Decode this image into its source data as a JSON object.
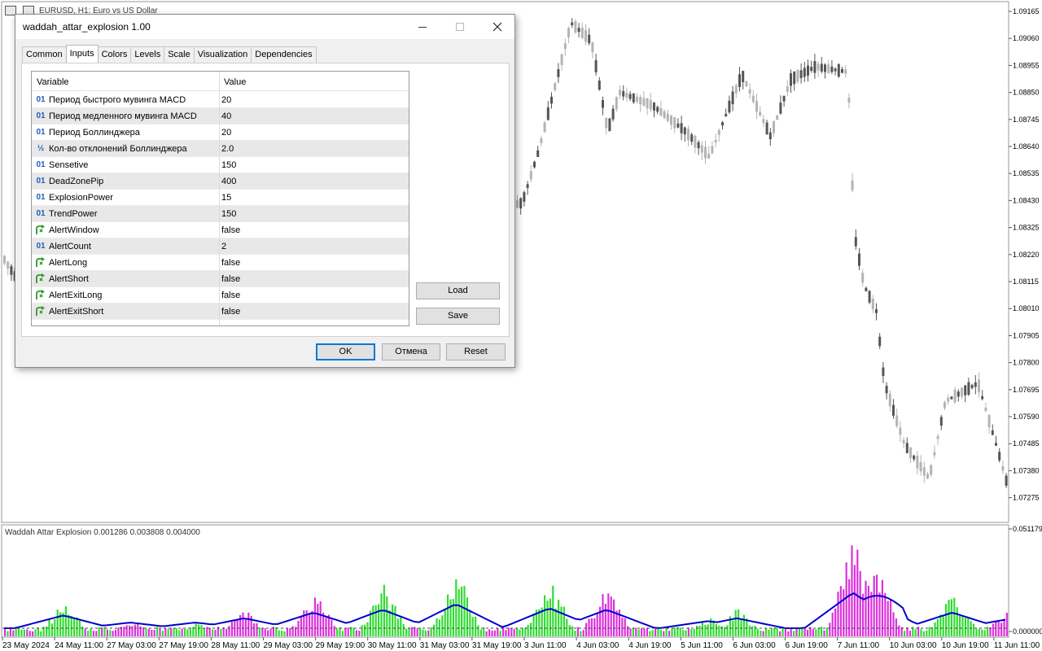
{
  "chart": {
    "title": "EURUSD, H1:  Euro vs US Dollar",
    "price_axis": [
      "1.09165",
      "1.09060",
      "1.08955",
      "1.08850",
      "1.08745",
      "1.08640",
      "1.08535",
      "1.08430",
      "1.08325",
      "1.08220",
      "1.08115",
      "1.08010",
      "1.07905",
      "1.07800",
      "1.07695",
      "1.07590",
      "1.07485",
      "1.07380",
      "1.07275"
    ],
    "time_axis": [
      "23 May 2024",
      "24 May 11:00",
      "27 May 03:00",
      "27 May 19:00",
      "28 May 11:00",
      "29 May 03:00",
      "29 May 19:00",
      "30 May 11:00",
      "31 May 03:00",
      "31 May 19:00",
      "3 Jun 11:00",
      "4 Jun 03:00",
      "4 Jun 19:00",
      "5 Jun 11:00",
      "6 Jun 03:00",
      "6 Jun 19:00",
      "7 Jun 11:00",
      "10 Jun 03:00",
      "10 Jun 19:00",
      "11 Jun 11:00"
    ],
    "indicator_title": "Waddah Attar Explosion 0.001286 0.003808 0.004000",
    "indicator_axis": [
      "0.051179",
      "0.000000"
    ],
    "colors": {
      "up": "#32dc32",
      "down": "#dc32dc",
      "explosion_line": "#0000cc",
      "candle_bull": "#b4b4b4",
      "candle_bear": "#555555"
    }
  },
  "dialog": {
    "title": "waddah_attar_explosion 1.00",
    "tabs": [
      {
        "label": "Common",
        "active": false
      },
      {
        "label": "Inputs",
        "active": true
      },
      {
        "label": "Colors",
        "active": false
      },
      {
        "label": "Levels",
        "active": false
      },
      {
        "label": "Scale",
        "active": false
      },
      {
        "label": "Visualization",
        "active": false
      },
      {
        "label": "Dependencies",
        "active": false
      }
    ],
    "grid_headers": {
      "variable": "Variable",
      "value": "Value"
    },
    "inputs": [
      {
        "icon": "int-icon",
        "icon_glyph": "01",
        "name": "Период быстрого мувинга MACD",
        "value": "20"
      },
      {
        "icon": "int-icon",
        "icon_glyph": "01",
        "name": "Период медленного мувинга MACD",
        "value": "40"
      },
      {
        "icon": "int-icon",
        "icon_glyph": "01",
        "name": "Период Боллинджера",
        "value": "20"
      },
      {
        "icon": "double-icon",
        "icon_glyph": "½",
        "name": "Кол-во отклонений Боллинджера",
        "value": "2.0"
      },
      {
        "icon": "int-icon",
        "icon_glyph": "01",
        "name": "Sensetive",
        "value": "150"
      },
      {
        "icon": "int-icon",
        "icon_glyph": "01",
        "name": "DeadZonePip",
        "value": "400"
      },
      {
        "icon": "int-icon",
        "icon_glyph": "01",
        "name": "ExplosionPower",
        "value": "15"
      },
      {
        "icon": "int-icon",
        "icon_glyph": "01",
        "name": "TrendPower",
        "value": "150"
      },
      {
        "icon": "bool-icon",
        "icon_glyph": "",
        "name": "AlertWindow",
        "value": "false"
      },
      {
        "icon": "int-icon",
        "icon_glyph": "01",
        "name": "AlertCount",
        "value": "2"
      },
      {
        "icon": "bool-icon",
        "icon_glyph": "",
        "name": "AlertLong",
        "value": "false"
      },
      {
        "icon": "bool-icon",
        "icon_glyph": "",
        "name": "AlertShort",
        "value": "false"
      },
      {
        "icon": "bool-icon",
        "icon_glyph": "",
        "name": "AlertExitLong",
        "value": "false"
      },
      {
        "icon": "bool-icon",
        "icon_glyph": "",
        "name": "AlertExitShort",
        "value": "false"
      }
    ],
    "buttons": {
      "load": "Load",
      "save": "Save",
      "ok": "OK",
      "cancel": "Отмена",
      "reset": "Reset"
    }
  }
}
